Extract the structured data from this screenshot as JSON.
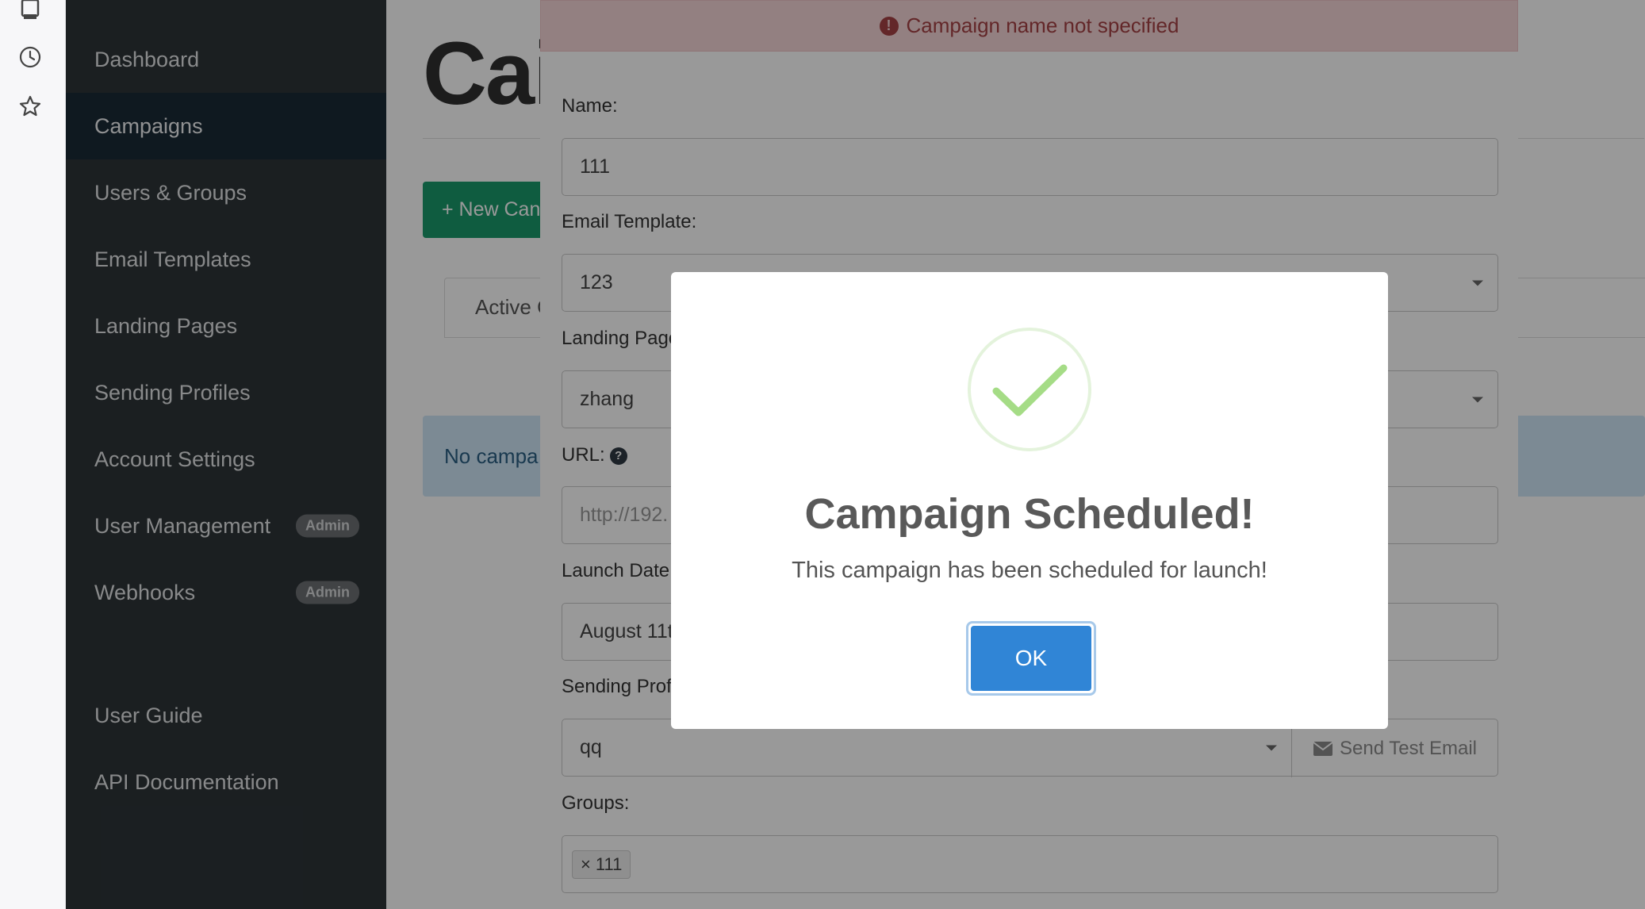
{
  "sidebar": {
    "items": [
      {
        "label": "Dashboard"
      },
      {
        "label": "Campaigns"
      },
      {
        "label": "Users & Groups"
      },
      {
        "label": "Email Templates"
      },
      {
        "label": "Landing Pages"
      },
      {
        "label": "Sending Profiles"
      },
      {
        "label": "Account Settings"
      },
      {
        "label": "User Management",
        "badge": "Admin"
      },
      {
        "label": "Webhooks",
        "badge": "Admin"
      }
    ],
    "footer_items": [
      {
        "label": "User Guide"
      },
      {
        "label": "API Documentation"
      }
    ],
    "active_item": "Campaigns"
  },
  "main": {
    "title": "Cai",
    "new_button_label": "+ New Can",
    "tab_label": "Active C",
    "alert_text": "No campa"
  },
  "campaign_form": {
    "error_message": "Campaign name not specified",
    "name_label": "Name:",
    "name_value": "111",
    "template_label": "Email Template:",
    "template_value": "123",
    "landing_label": "Landing Page",
    "landing_value": "zhang",
    "url_label": "URL:",
    "url_placeholder": "http://192.",
    "launch_label": "Launch Date",
    "launch_value": "August 11t",
    "profile_label": "Sending Prof",
    "profile_value": "qq",
    "send_test_label": "Send Test Email",
    "groups_label": "Groups:",
    "group_tag": "111"
  },
  "dialog": {
    "title": "Campaign Scheduled!",
    "text": "This campaign has been scheduled for launch!",
    "ok_label": "OK"
  },
  "colors": {
    "sidebar_bg": "#2d3438",
    "active_bg": "#1a2a36",
    "success_check": "#a5dc86",
    "ok_button": "#3085d6",
    "error_text": "#a64145"
  },
  "icons": [
    "extension-icon",
    "history-icon",
    "star-icon",
    "error-icon",
    "question-icon",
    "envelope-icon",
    "checkmark-icon"
  ]
}
